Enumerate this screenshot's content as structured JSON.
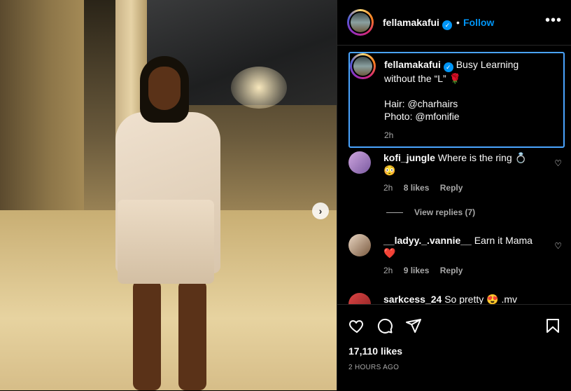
{
  "post": {
    "username": "fellamakafui",
    "follow_label": "Follow",
    "separator": "•",
    "more_label": "•••",
    "next_label": "›"
  },
  "caption": {
    "username": "fellamakafui",
    "line1": "Busy Learning",
    "line2": "without the “L” 🌹",
    "line3": "Hair: @charhairs",
    "line4": "Photo: @mfonifie",
    "time": "2h"
  },
  "comments": [
    {
      "username": "kofi_jungle",
      "text": "Where is the ring 💍",
      "text2": "😳",
      "time": "2h",
      "likes": "8 likes",
      "reply": "Reply"
    },
    {
      "username": "__ladyy._.vannie__",
      "text": "Earn it Mama",
      "text2": "❤️",
      "time": "2h",
      "likes": "9 likes",
      "reply": "Reply"
    },
    {
      "username": "sarkcess_24",
      "text": "So pretty 😍 .mv"
    }
  ],
  "view_replies": "View replies (7)",
  "actions": {
    "likes": "17,110 likes",
    "ago": "2 HOURS AGO"
  }
}
